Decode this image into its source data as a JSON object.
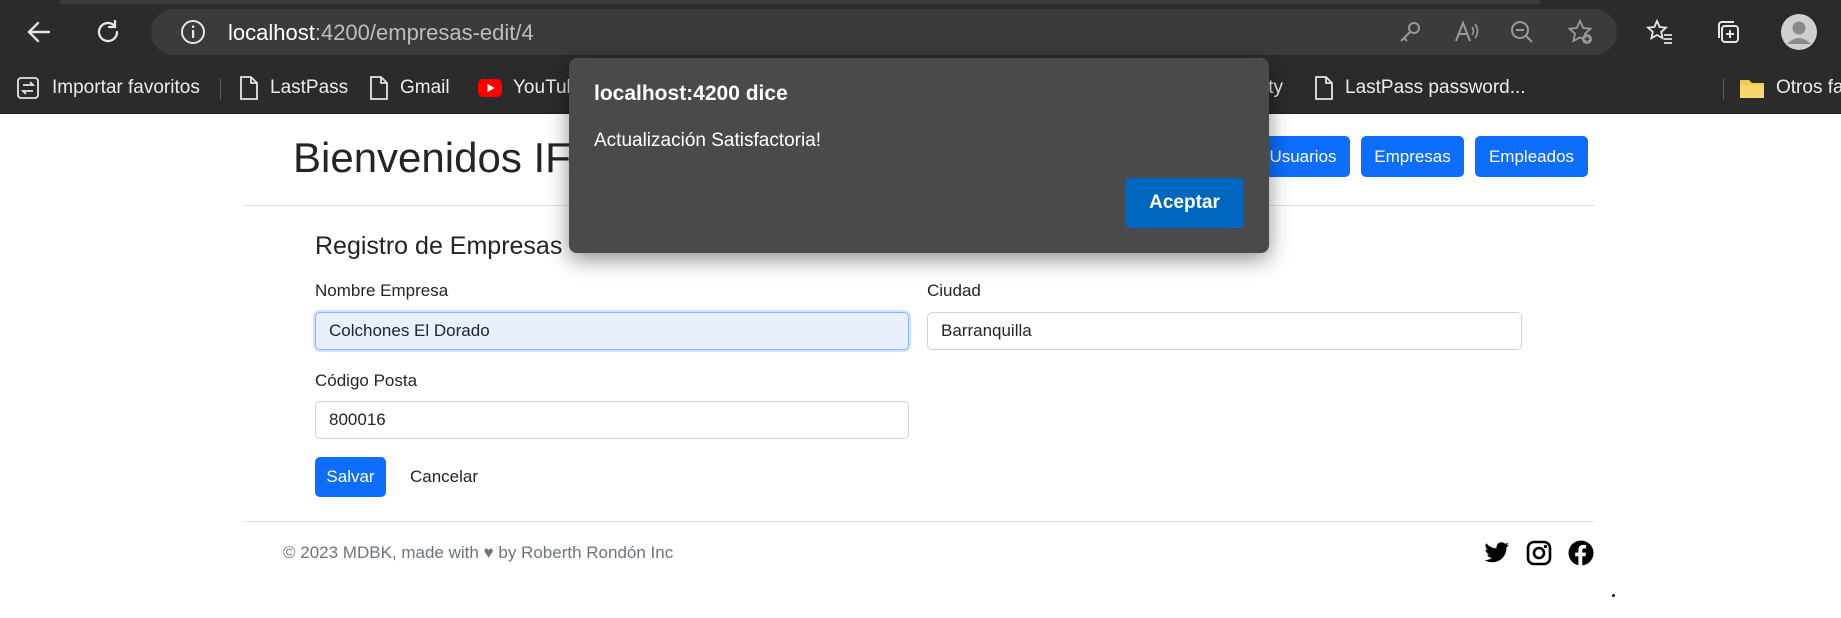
{
  "browser": {
    "url_host": "localhost",
    "url_rest": ":4200/empresas-edit/4",
    "bookmarks": [
      "Importar favoritos",
      "LastPass",
      "Gmail",
      "YouTube",
      "ity",
      "LastPass password...",
      "Otros fa"
    ]
  },
  "header": {
    "brand": "Bienvenidos IFA",
    "nav": [
      "Usuarios",
      "Empresas",
      "Empleados"
    ]
  },
  "form": {
    "title": "Registro de Empresas",
    "name_label": "Nombre Empresa",
    "name_value": "Colchones El Dorado",
    "city_label": "Ciudad",
    "city_value": "Barranquilla",
    "postal_label": "Código Posta",
    "postal_value": "800016",
    "save_label": "Salvar",
    "cancel_label": "Cancelar"
  },
  "footer": {
    "text": "© 2023 MDBK, made with ♥ by Roberth Rondón Inc",
    "social": [
      "twitter-icon",
      "instagram-icon",
      "facebook-icon"
    ]
  },
  "dialog": {
    "title": "localhost:4200 dice",
    "message": "Actualización Satisfactoria!",
    "accept_label": "Aceptar"
  },
  "colors": {
    "primary": "#0d6efd",
    "dialog_bg": "#4a4a4a",
    "dialog_button": "#0067c0",
    "chrome_bg": "#2b2b2b"
  }
}
